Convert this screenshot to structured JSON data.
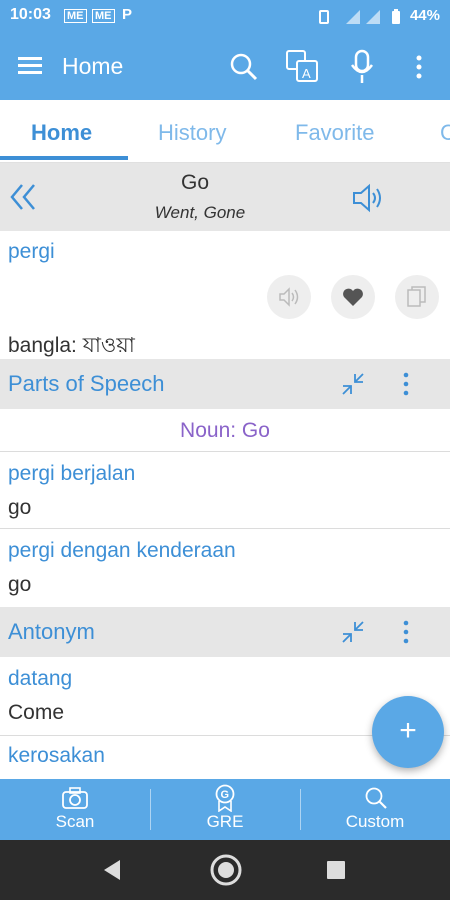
{
  "status_bar": {
    "time": "10:03",
    "notif_icons": [
      "ME",
      "ME",
      "P"
    ],
    "battery": "44%"
  },
  "app_bar": {
    "title": "Home",
    "icons": [
      "menu-icon",
      "search-icon",
      "translate-icon",
      "microphone-icon",
      "more-vert-icon"
    ]
  },
  "tabs": [
    {
      "label": "Home",
      "active": true
    },
    {
      "label": "History",
      "active": false
    },
    {
      "label": "Favorite",
      "active": false
    },
    {
      "label": "C",
      "active": false
    }
  ],
  "word": {
    "headword": "Go",
    "forms": "Went, Gone"
  },
  "translation": {
    "text": "pergi",
    "bangla_label": "bangla:",
    "bangla_value": "যাওয়া"
  },
  "parts_of_speech": {
    "title": "Parts of Speech",
    "noun_line": "Noun: Go",
    "entries": [
      {
        "label": "pergi berjalan",
        "value": "go"
      },
      {
        "label": "pergi dengan kenderaan",
        "value": "go"
      }
    ]
  },
  "antonym": {
    "title": "Antonym",
    "entries": [
      {
        "label": "datang",
        "value": "Come"
      },
      {
        "label": "kerosakan",
        "value": ""
      }
    ]
  },
  "fab": {
    "label": "+"
  },
  "bottom_nav": [
    {
      "label": "Scan",
      "icon": "camera-icon"
    },
    {
      "label": "GRE",
      "icon": "gre-badge-icon"
    },
    {
      "label": "Custom",
      "icon": "search-icon"
    }
  ],
  "colors": {
    "primary": "#5aa8e6",
    "accent": "#3d8fd6",
    "noun": "#8a63c9"
  }
}
